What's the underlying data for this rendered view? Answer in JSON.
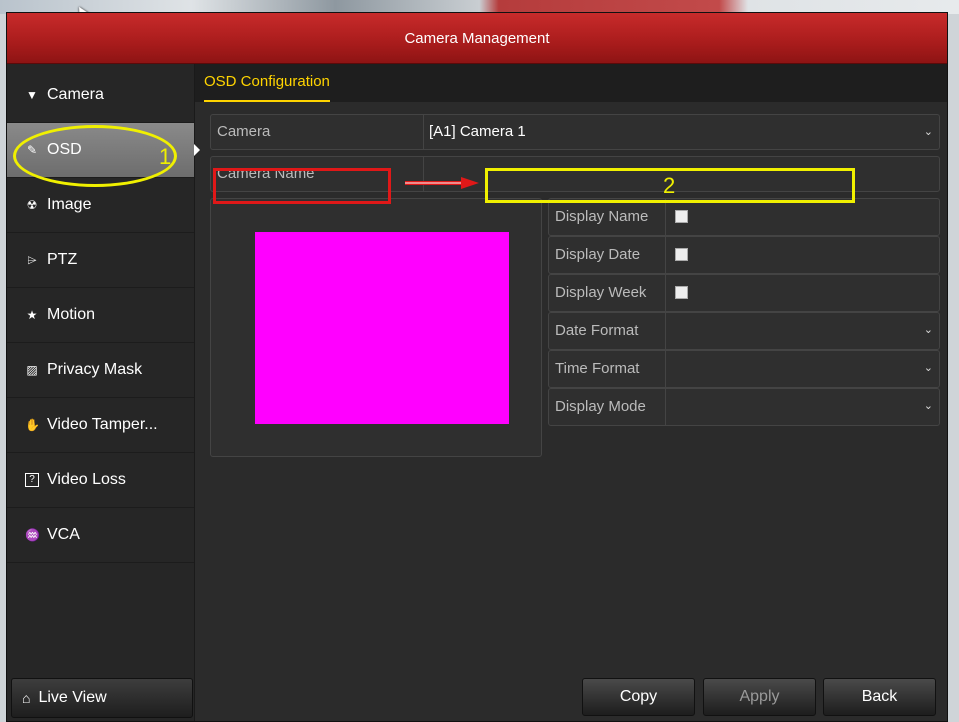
{
  "window": {
    "title": "Camera Management"
  },
  "sidebar": {
    "items": [
      {
        "label": "Camera",
        "icon": "camera-icon",
        "glyph": "▼"
      },
      {
        "label": "OSD",
        "icon": "osd-icon",
        "glyph": "✎"
      },
      {
        "label": "Image",
        "icon": "image-icon",
        "glyph": "☢"
      },
      {
        "label": "PTZ",
        "icon": "ptz-icon",
        "glyph": "⌲"
      },
      {
        "label": "Motion",
        "icon": "motion-icon",
        "glyph": "★"
      },
      {
        "label": "Privacy Mask",
        "icon": "privacy-mask-icon",
        "glyph": "▨"
      },
      {
        "label": "Video Tamper...",
        "icon": "video-tamper-icon",
        "glyph": "✋"
      },
      {
        "label": "Video Loss",
        "icon": "video-loss-icon",
        "glyph": "?"
      },
      {
        "label": "VCA",
        "icon": "vca-icon",
        "glyph": "♒"
      }
    ],
    "active_index": 1,
    "live_view": {
      "label": "Live View",
      "icon": "home-icon",
      "glyph": "⌂"
    }
  },
  "tab": {
    "label": "OSD Configuration"
  },
  "form": {
    "camera": {
      "label": "Camera",
      "value": "[A1] Camera 1"
    },
    "camera_name": {
      "label": "Camera Name",
      "value": ""
    }
  },
  "options": [
    {
      "label": "Display Name",
      "type": "checkbox",
      "checked": false
    },
    {
      "label": "Display Date",
      "type": "checkbox",
      "checked": false
    },
    {
      "label": "Display Week",
      "type": "checkbox",
      "checked": false
    },
    {
      "label": "Date Format",
      "type": "select",
      "value": ""
    },
    {
      "label": "Time Format",
      "type": "select",
      "value": ""
    },
    {
      "label": "Display Mode",
      "type": "select",
      "value": ""
    }
  ],
  "buttons": {
    "copy": "Copy",
    "apply": "Apply",
    "back": "Back"
  },
  "annotations": {
    "marker_1": "1",
    "marker_2": "2"
  },
  "colors": {
    "titlebar": "#b22222",
    "accent": "#ffd400",
    "preview": "#ff00ff",
    "annotation_yellow": "#f0f000",
    "annotation_red": "#e01818"
  }
}
